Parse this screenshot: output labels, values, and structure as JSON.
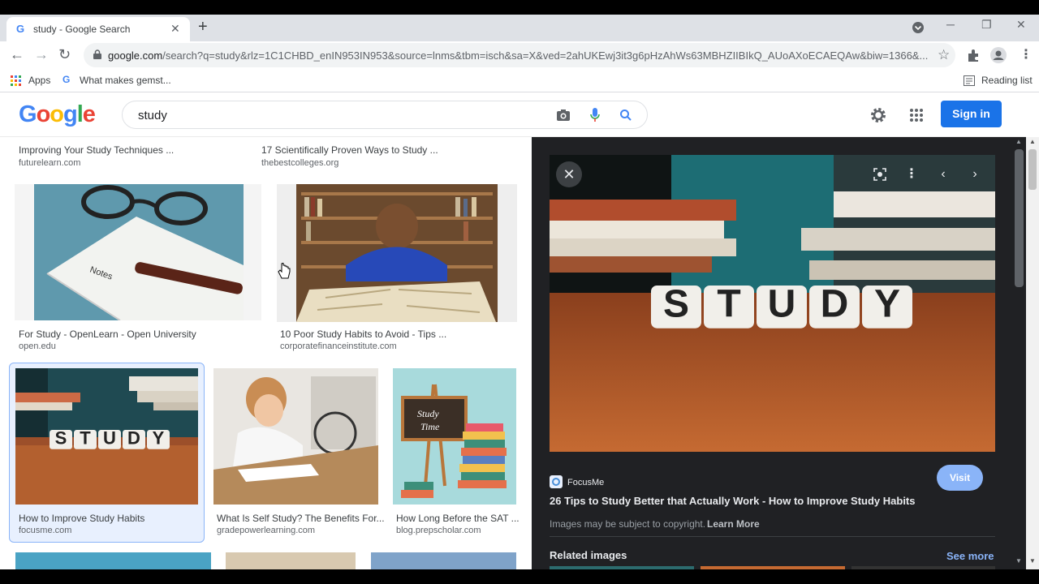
{
  "browser": {
    "tab_title": "study - Google Search",
    "url_host": "google.com",
    "url_path": "/search?q=study&rlz=1C1CHBD_enIN953IN953&source=lnms&tbm=isch&sa=X&ved=2ahUKEwj3it3g6pHzAhWs63MBHZIIBIkQ_AUoAXoECAEQAw&biw=1366&...",
    "bookmarks": {
      "apps": "Apps",
      "gemstone": "What makes gemst...",
      "reading_list": "Reading list"
    }
  },
  "google": {
    "logo": [
      "G",
      "o",
      "o",
      "g",
      "l",
      "e"
    ],
    "logo_colors": [
      "#4285f4",
      "#ea4335",
      "#fbbc05",
      "#4285f4",
      "#34a853",
      "#ea4335"
    ],
    "query": "study",
    "sign_in": "Sign in"
  },
  "results": [
    {
      "title": "Improving Your Study Techniques ...",
      "site": "futurelearn.com"
    },
    {
      "title": "17 Scientifically Proven Ways to Study ...",
      "site": "thebestcolleges.org"
    },
    {
      "title": "For Study - OpenLearn - Open University",
      "site": "open.edu"
    },
    {
      "title": "10 Poor Study Habits to Avoid - Tips ...",
      "site": "corporatefinanceinstitute.com"
    },
    {
      "title": "How to Improve Study Habits",
      "site": "focusme.com"
    },
    {
      "title": "What Is Self Study? The Benefits For...",
      "site": "gradepowerlearning.com"
    },
    {
      "title": "How Long Before the SAT ...",
      "site": "blog.prepscholar.com"
    }
  ],
  "image_text": {
    "study_blocks": [
      "S",
      "T",
      "U",
      "D",
      "Y"
    ],
    "chalkboard": "Study Time",
    "notebook": "Notes"
  },
  "panel": {
    "source": "FocusMe",
    "title": "26 Tips to Study Better that Actually Work - How to Improve Study Habits",
    "visit": "Visit",
    "copyright": "Images may be subject to copyright.",
    "learn_more": "Learn More",
    "related": "Related images",
    "see_more": "See more"
  },
  "colors": {
    "accent": "#1a73e8",
    "panel_bg": "#202124",
    "link_blue": "#8ab4f8"
  }
}
